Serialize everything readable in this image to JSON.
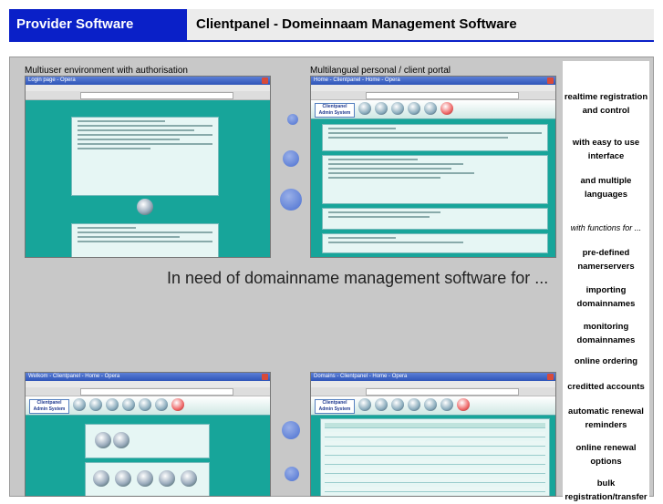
{
  "header": {
    "left_title": "Provider Software",
    "right_title": "Clientpanel - Domeinnaam Management Software"
  },
  "captions": {
    "top_left": "Multiuser environment with authorisation",
    "top_right": "Multilangual personal / client portal"
  },
  "center_text": "In need of domainname management software for ...",
  "features": [
    {
      "label": "realtime registration and control",
      "style": "bold"
    },
    {
      "label": "with easy to use interface",
      "style": "bold"
    },
    {
      "label": "and multiple languages",
      "style": "bold"
    },
    {
      "label": "with functions for ...",
      "style": "italic"
    },
    {
      "label": "pre-defined namerservers",
      "style": "bold"
    },
    {
      "label": "importing domainnames",
      "style": "bold"
    },
    {
      "label": "monitoring domainnames",
      "style": "bold"
    },
    {
      "label": "online ordering",
      "style": "bold"
    },
    {
      "label": "creditted accounts",
      "style": "bold"
    },
    {
      "label": "automatic renewal reminders",
      "style": "bold"
    },
    {
      "label": "online renewal options",
      "style": "bold"
    },
    {
      "label": "bulk registration/transfer",
      "style": "bold"
    }
  ],
  "screenshots": {
    "login": {
      "window_title": "Login page - Opera"
    },
    "portal": {
      "window_title": "Home - Clientpanel - Home - Opera"
    },
    "welcome": {
      "window_title": "Welkom - Clientpanel - Home - Opera"
    },
    "domains": {
      "window_title": "Domains - Clientpanel - Home - Opera"
    }
  },
  "app_logo": "Clientpanel Admin System",
  "colors": {
    "header_blue": "#0a20c8",
    "header_gray": "#ececec",
    "teal": "#17a59a",
    "bubble": "#4a6fd0"
  }
}
